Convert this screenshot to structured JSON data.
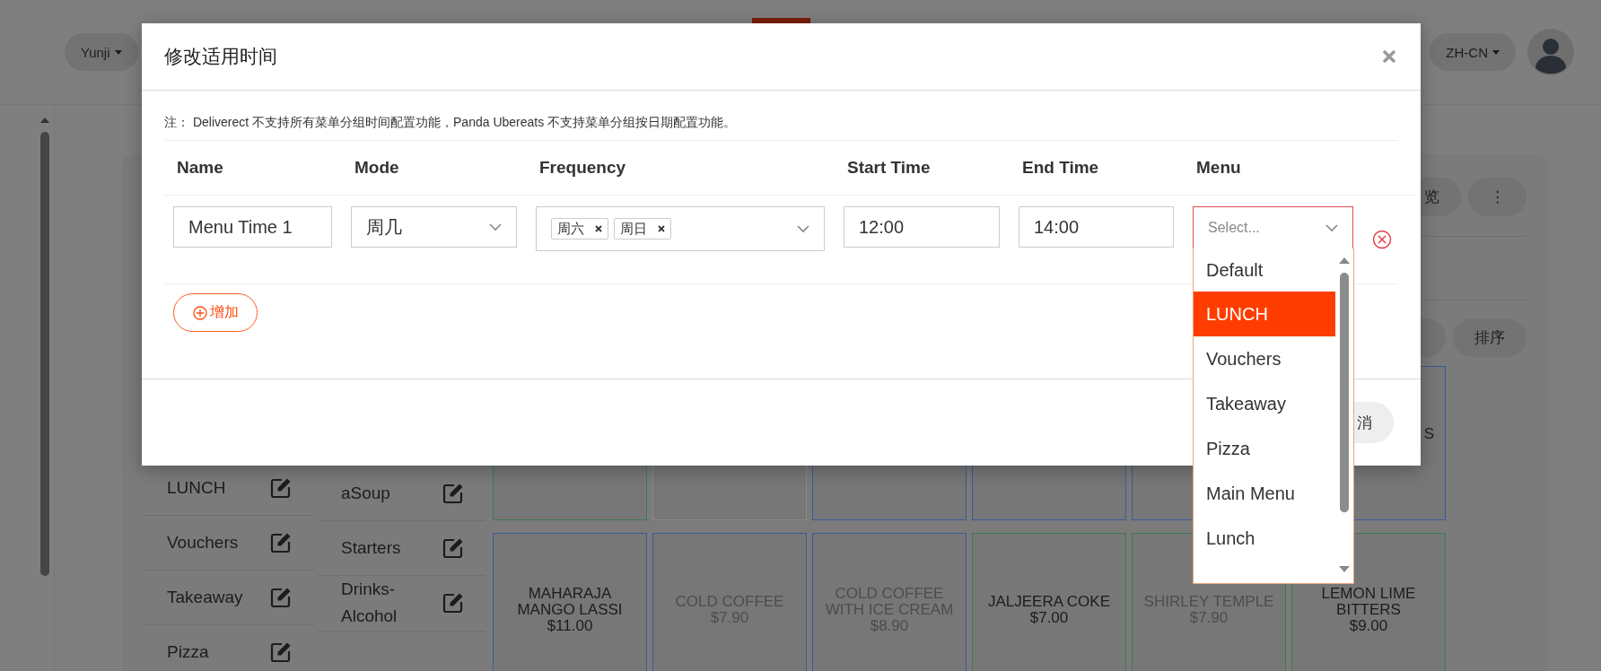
{
  "header": {
    "account": "Yunji",
    "language": "ZH-CN"
  },
  "background": {
    "toolbar_buttons": [
      "览",
      "⋮"
    ],
    "action_buttons": [
      "排序"
    ],
    "categories": [
      "LUNCH",
      "Vouchers",
      "Takeaway",
      "Pizza"
    ],
    "groups": [
      "aSoup",
      "Starters",
      "Drinks-Alcohol"
    ],
    "products": [
      {
        "color": "#3d7a52"
      },
      {
        "color": "#8a8a8a"
      },
      {
        "color": "#3b5a9a"
      },
      {
        "color": "#3b5a9a"
      },
      {
        "color": "#3b5a9a"
      },
      {
        "color": "#3b5a9a",
        "name": "S"
      },
      {
        "color": "#3b5a9a",
        "name": "MAHARAJA MANGO LASSI",
        "price": "$11.00",
        "disabled": false
      },
      {
        "color": "#3b5a9a",
        "name": "COLD COFFEE",
        "price": "$7.90",
        "disabled": true
      },
      {
        "color": "#3b5a9a",
        "name": "COLD COFFEE WITH ICE CREAM",
        "price": "$8.90",
        "disabled": true
      },
      {
        "color": "#3d7a52",
        "name": "JALJEERA COKE",
        "price": "$7.00",
        "disabled": false
      },
      {
        "color": "#3d7a52",
        "name": "SHIRLEY TEMPLE",
        "price": "$7.90",
        "disabled": true
      },
      {
        "color": "#3d7a52",
        "name": "LEMON LIME BITTERS",
        "price": "$9.00",
        "disabled": false
      }
    ]
  },
  "modal": {
    "title": "修改适用时间",
    "note": "注： Deliverect 不支持所有菜单分组时间配置功能，Panda Ubereats 不支持菜单分组按日期配置功能。",
    "columns": [
      "Name",
      "Mode",
      "Frequency",
      "Start Time",
      "End Time",
      "Menu"
    ],
    "rows": [
      {
        "name": "Menu Time 1",
        "mode": "周几",
        "frequency": [
          "周六",
          "周日"
        ],
        "start_time": "12:00",
        "end_time": "14:00",
        "menu_placeholder": "Select..."
      }
    ],
    "add_button": "增加",
    "cancel_button": "消"
  },
  "menu_dropdown": {
    "options": [
      {
        "label": "Default",
        "selected": false
      },
      {
        "label": "LUNCH",
        "selected": true
      },
      {
        "label": "Vouchers",
        "selected": false
      },
      {
        "label": "Takeaway",
        "selected": false
      },
      {
        "label": "Pizza",
        "selected": false
      },
      {
        "label": "Main Menu",
        "selected": false
      },
      {
        "label": "Lunch",
        "selected": false
      }
    ]
  }
}
